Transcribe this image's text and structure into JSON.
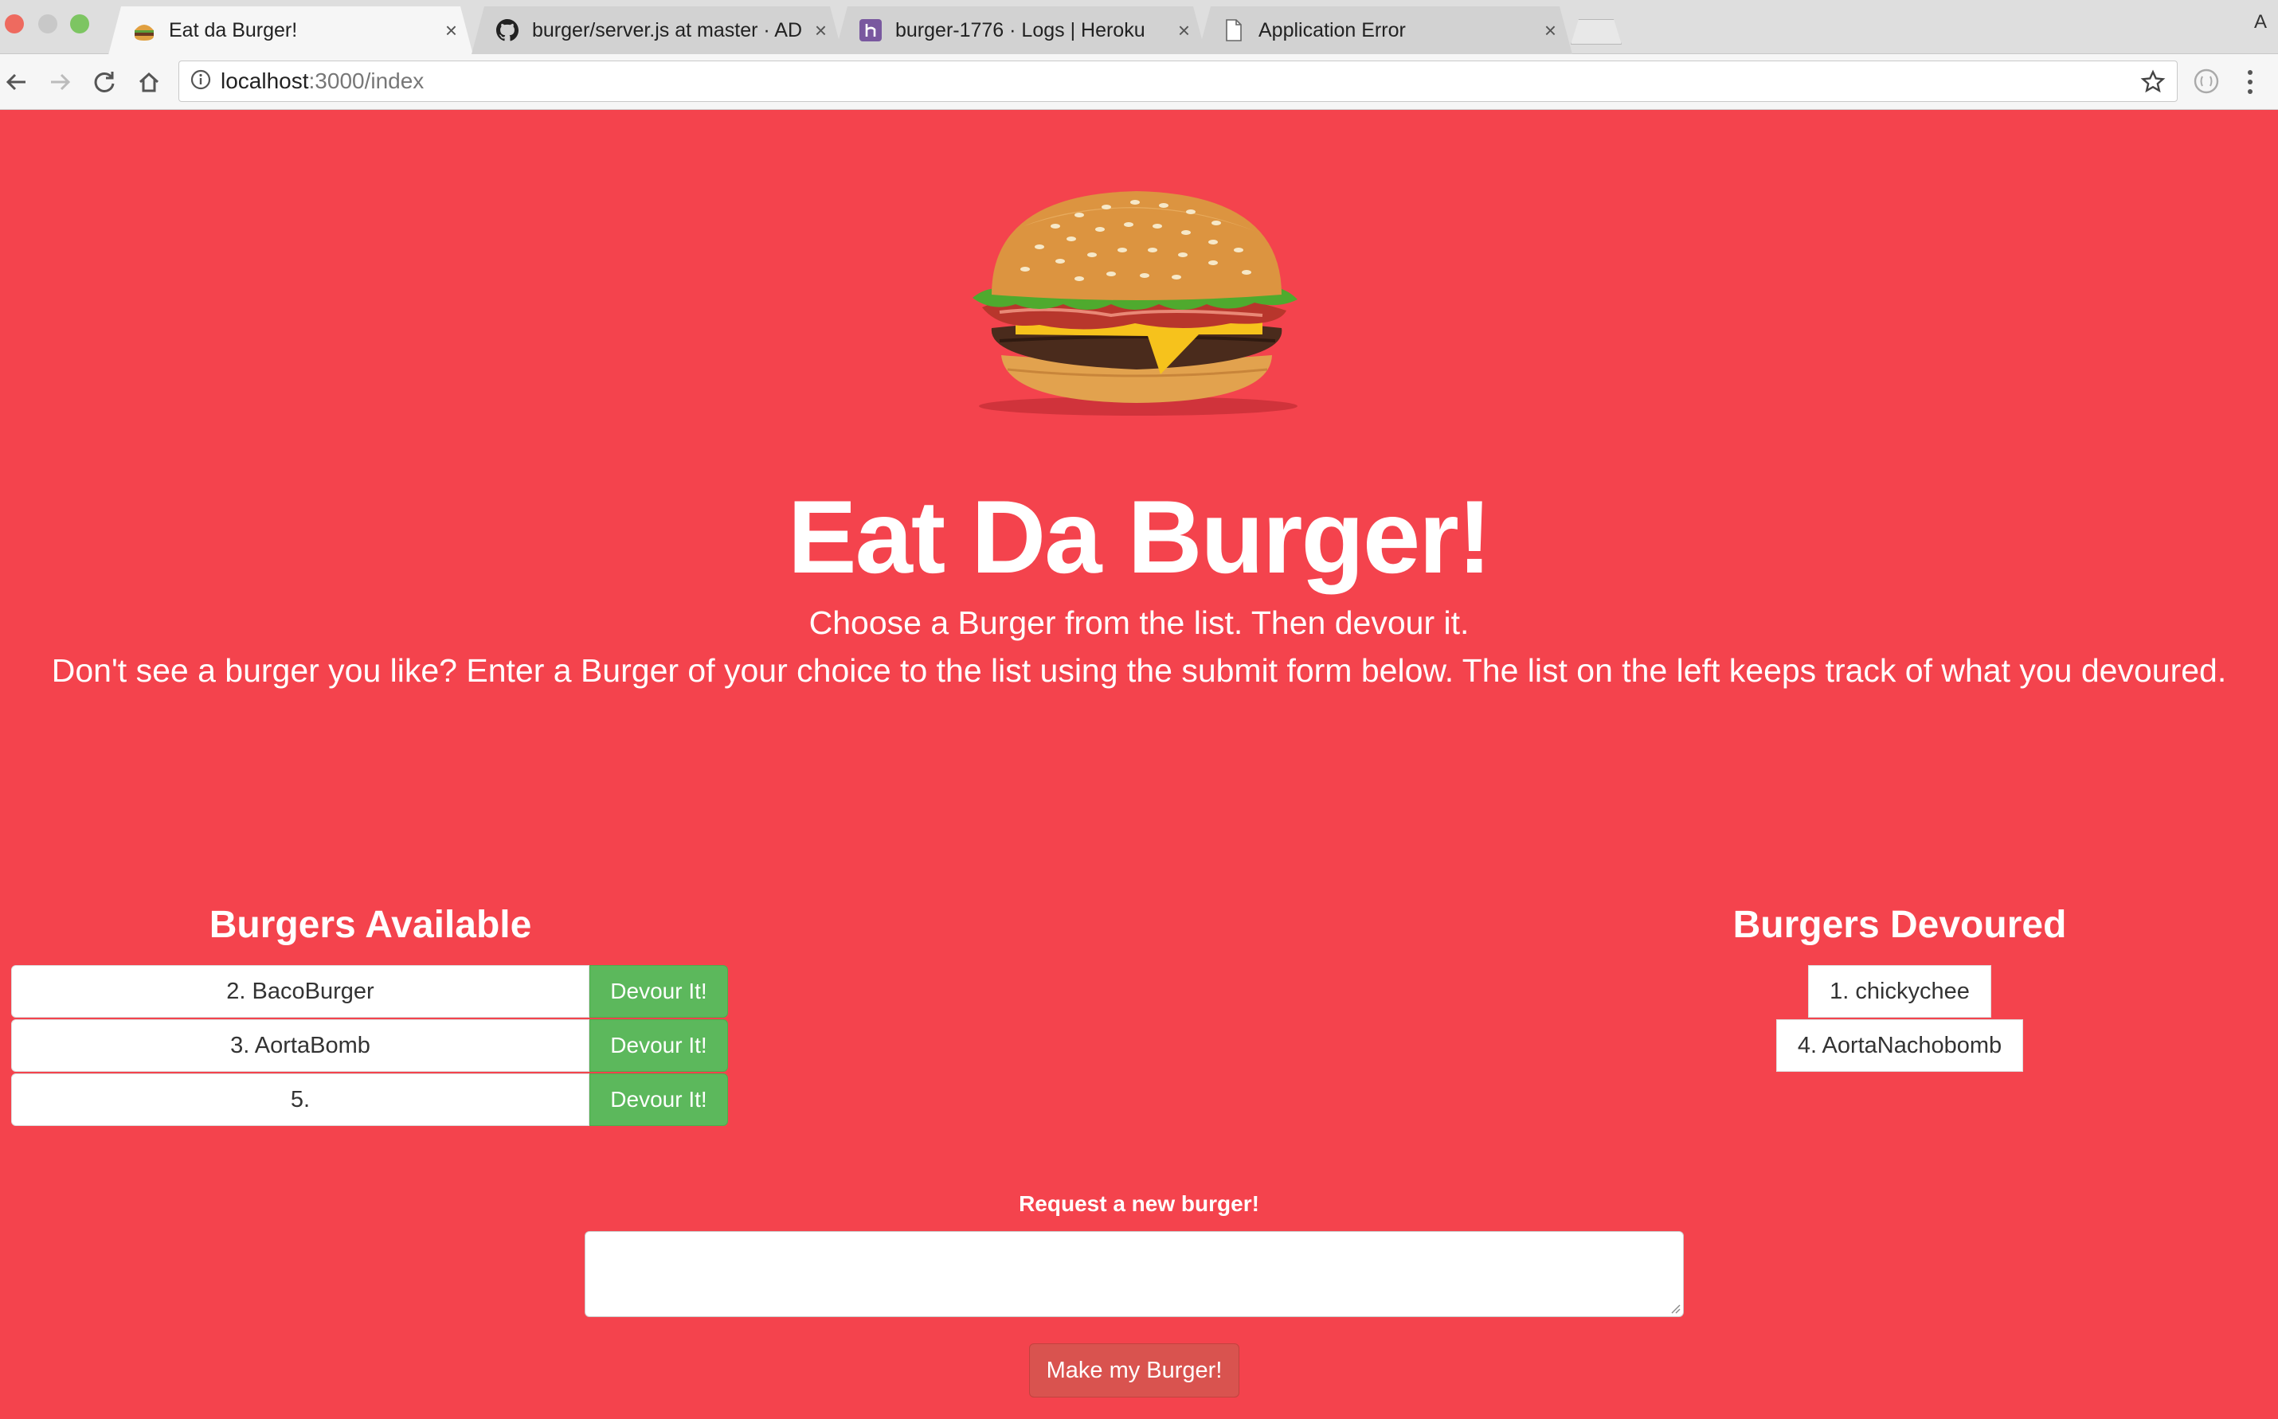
{
  "browser": {
    "tabs": [
      {
        "title": "Eat da Burger!",
        "icon": "burger-favicon",
        "active": true
      },
      {
        "title": "burger/server.js at master · AD",
        "icon": "github-icon",
        "active": false
      },
      {
        "title": "burger-1776 · Logs | Heroku",
        "icon": "heroku-icon",
        "active": false
      },
      {
        "title": "Application Error",
        "icon": "document-icon",
        "active": false
      }
    ],
    "close_glyph": "×",
    "profile_initial": "A",
    "url_host": "localhost",
    "url_path": ":3000/index"
  },
  "page": {
    "title": "Eat Da Burger!",
    "subtitle": "Choose a Burger from the list. Then devour it.",
    "subtitle2": "Don't see a burger you like? Enter a Burger of your choice to the list using the submit form below. The list on the left keeps track of what you devoured.",
    "available_heading": "Burgers Available",
    "devoured_heading": "Burgers Devoured",
    "available": [
      {
        "label": "2. BacoBurger",
        "button": "Devour It!"
      },
      {
        "label": "3. AortaBomb",
        "button": "Devour It!"
      },
      {
        "label": "5.",
        "button": "Devour It!"
      }
    ],
    "devoured": [
      "1. chickychee",
      "4. AortaNachobomb"
    ],
    "form_label": "Request a new burger!",
    "input_value": "",
    "submit_label": "Make my Burger!"
  },
  "colors": {
    "background": "#f4434d",
    "devour_button": "#5cb85c",
    "submit_button": "#d9534f"
  }
}
